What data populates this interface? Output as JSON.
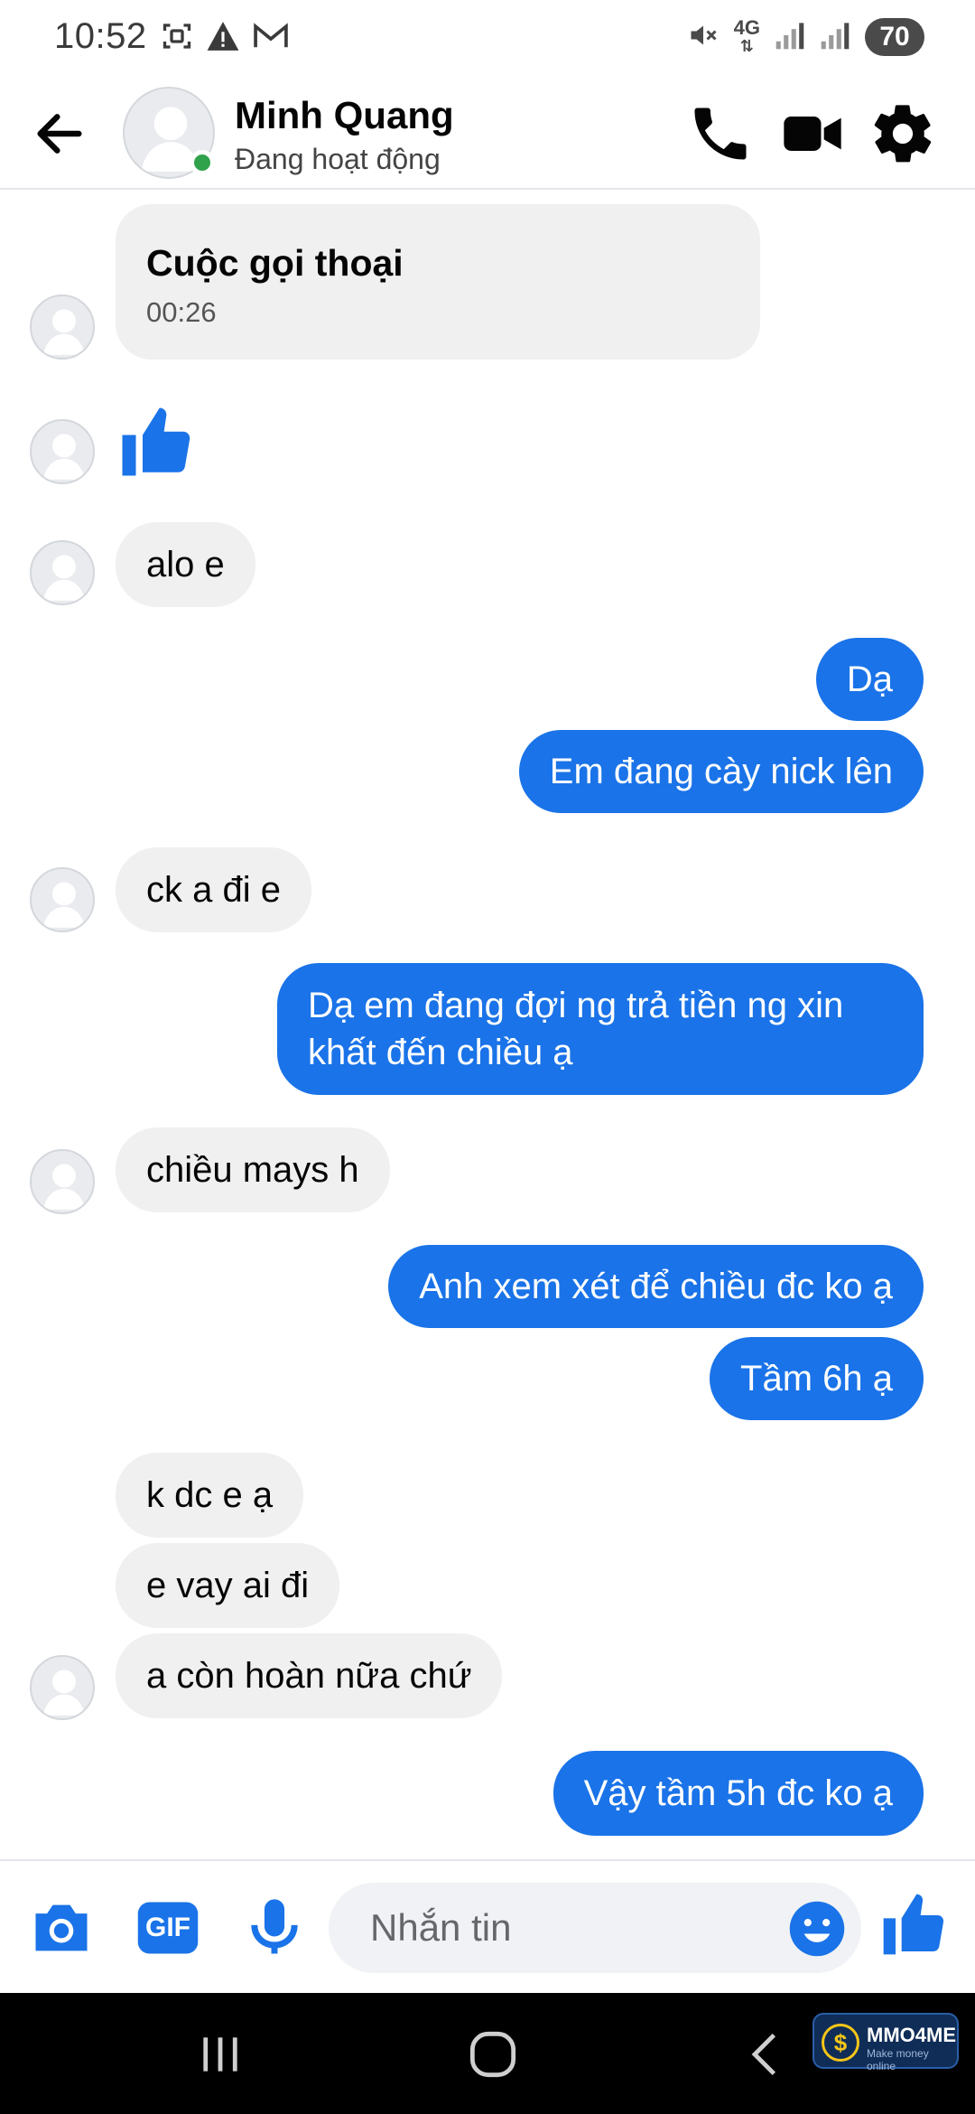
{
  "status_bar": {
    "time": "10:52",
    "network": "4G",
    "battery": "70",
    "left_icons": [
      "screenshot-icon",
      "warning-icon",
      "gmail-icon"
    ],
    "right_icons": [
      "mute-icon",
      "network-4g-icon",
      "signal-icon",
      "signal-icon"
    ]
  },
  "header": {
    "name": "Minh Quang",
    "status": "Đang hoạt động",
    "icons": [
      "back-arrow-icon",
      "phone-icon",
      "video-camera-icon",
      "gear-icon"
    ]
  },
  "messages": [
    {
      "side": "in",
      "kind": "call",
      "title": "Cuộc gọi thoại",
      "duration": "00:26"
    },
    {
      "side": "in",
      "kind": "like"
    },
    {
      "side": "in",
      "text": "alo e"
    },
    {
      "side": "out",
      "text": "Dạ"
    },
    {
      "side": "out",
      "text": "Em đang cày nick lên"
    },
    {
      "side": "in",
      "text": "ck a đi e"
    },
    {
      "side": "out",
      "text": "Dạ em đang đợi ng trả tiền ng xin khất đến chiều ạ"
    },
    {
      "side": "in",
      "text": "chiều mays h"
    },
    {
      "side": "out",
      "text": "Anh xem xét để chiều đc ko ạ"
    },
    {
      "side": "out",
      "text": "Tầm 6h ạ"
    },
    {
      "side": "in",
      "text": "k dc e ạ"
    },
    {
      "side": "in",
      "text": "e vay ai đi"
    },
    {
      "side": "in",
      "text": "a còn hoàn nữa chứ"
    },
    {
      "side": "out",
      "text": "Vậy tầm 5h đc ko ạ"
    }
  ],
  "composer": {
    "placeholder": "Nhắn tin",
    "gif_label": "GIF",
    "icons": [
      "camera-icon",
      "gif-icon",
      "microphone-icon",
      "emoji-icon",
      "like-icon"
    ]
  },
  "watermark": {
    "title": "MMO4ME",
    "subtitle": "Make money online",
    "coin": "$"
  },
  "colors": {
    "accent": "#1a73e8",
    "incoming_bubble": "#f0f0f0",
    "online": "#31a24c"
  }
}
